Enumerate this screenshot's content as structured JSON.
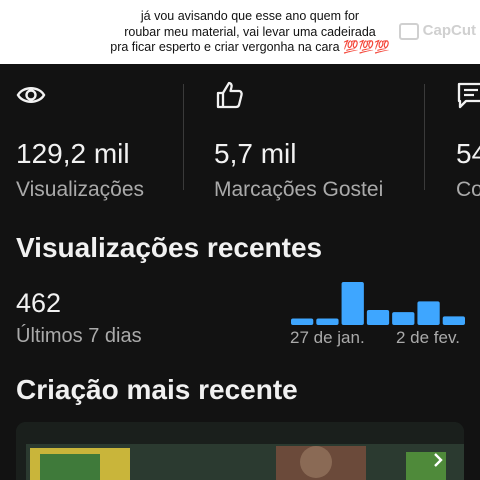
{
  "caption": {
    "lines": [
      "já vou avisando que esse ano quem for",
      "roubar meu material, vai levar uma cadeirada",
      "pra ficar esperto e criar vergonha na cara 💯💯💯"
    ]
  },
  "watermark": {
    "text": "CapCut"
  },
  "stats": [
    {
      "icon": "eye-icon",
      "value": "129,2 mil",
      "label": "Visualizações"
    },
    {
      "icon": "thumbs-up-icon",
      "value": "5,7 mil",
      "label": "Marcações Gostei"
    },
    {
      "icon": "comment-icon",
      "value": "54",
      "label": "Co"
    }
  ],
  "recent_views": {
    "title": "Visualizações recentes",
    "total": "462",
    "period_label": "Últimos 7 dias",
    "x_ticks": [
      "27 de jan.",
      "2 de fev."
    ],
    "bar_color": "#3ea6ff",
    "bars": [
      0.15,
      0.15,
      1.0,
      0.35,
      0.3,
      0.55,
      0.2
    ]
  },
  "latest": {
    "title": "Criação mais recente"
  },
  "colors": {
    "background": "#121212",
    "text_primary": "#f1f1f1",
    "text_secondary": "#aaaaaa",
    "accent": "#3ea6ff"
  }
}
